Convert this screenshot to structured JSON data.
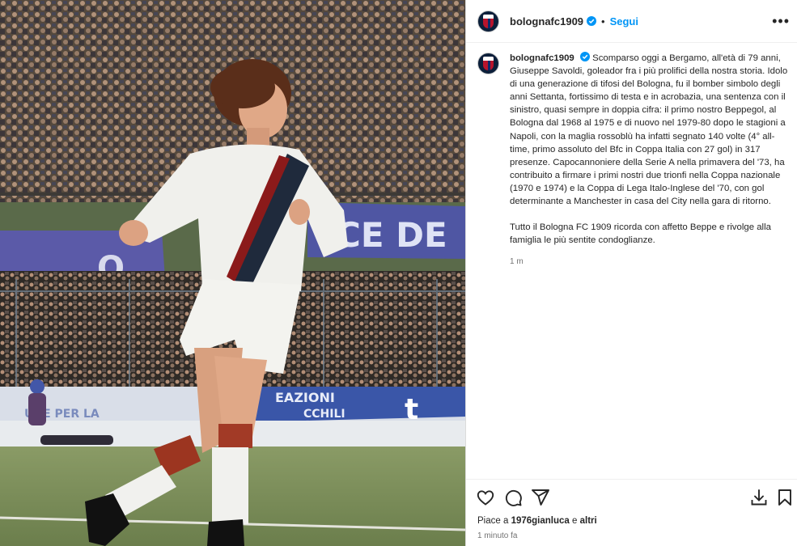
{
  "photo": {
    "banner_text_upper": "CE DE",
    "banner_text_lower": "EAZIONI",
    "banner_text_lower2": "CCHILI",
    "banner_text_left": "UNE PER LA",
    "banner_letter_t": "t"
  },
  "header": {
    "username": "bolognafc1909",
    "separator": "•",
    "follow_label": "Segui",
    "more_label": "•••"
  },
  "caption": {
    "username": "bolognafc1909",
    "paragraph_1": "Scomparso oggi a Bergamo, all'età di 79 anni, Giuseppe Savoldi, goleador fra i più prolifici della nostra storia. Idolo di una generazione di tifosi del Bologna, fu il bomber simbolo degli anni Settanta, fortissimo di testa e in acrobazia, una sentenza con il sinistro, quasi sempre in doppia cifra: il primo nostro Beppegol, al Bologna dal 1968 al 1975 e di nuovo nel 1979-80 dopo le stagioni a Napoli, con la maglia rossoblù ha infatti segnato 140 volte (4° all-time, primo assoluto del Bfc in Coppa Italia con 27 gol) in 317 presenze. Capocannoniere della Serie A nella primavera del '73, ha contribuito a firmare i primi nostri due trionfi nella Coppa nazionale (1970 e 1974) e la Coppa di Lega Italo-Inglese del '70, con gol determinante a Manchester in casa del City nella gara di ritorno.",
    "paragraph_2": "Tutto il Bologna FC 1909 ricorda con affetto Beppe e rivolge alla famiglia le più sentite condoglianze.",
    "time": "1 m"
  },
  "footer": {
    "likes_prefix": "Piace a",
    "likes_user": "1976gianluca",
    "likes_connector": "e",
    "likes_others": "altri",
    "posted_ago": "1 minuto fa"
  },
  "icons": {
    "like": "heart-icon",
    "comment": "comment-icon",
    "share": "share-icon",
    "download": "download-icon",
    "save": "bookmark-icon",
    "verified": "verified-badge-icon"
  },
  "colors": {
    "accent": "#0095f6",
    "verified": "#0095f6",
    "text": "#262626",
    "muted": "#737373",
    "shirt_stripe_red": "#8b1a1a",
    "shirt_stripe_blue": "#1f2a3c"
  }
}
